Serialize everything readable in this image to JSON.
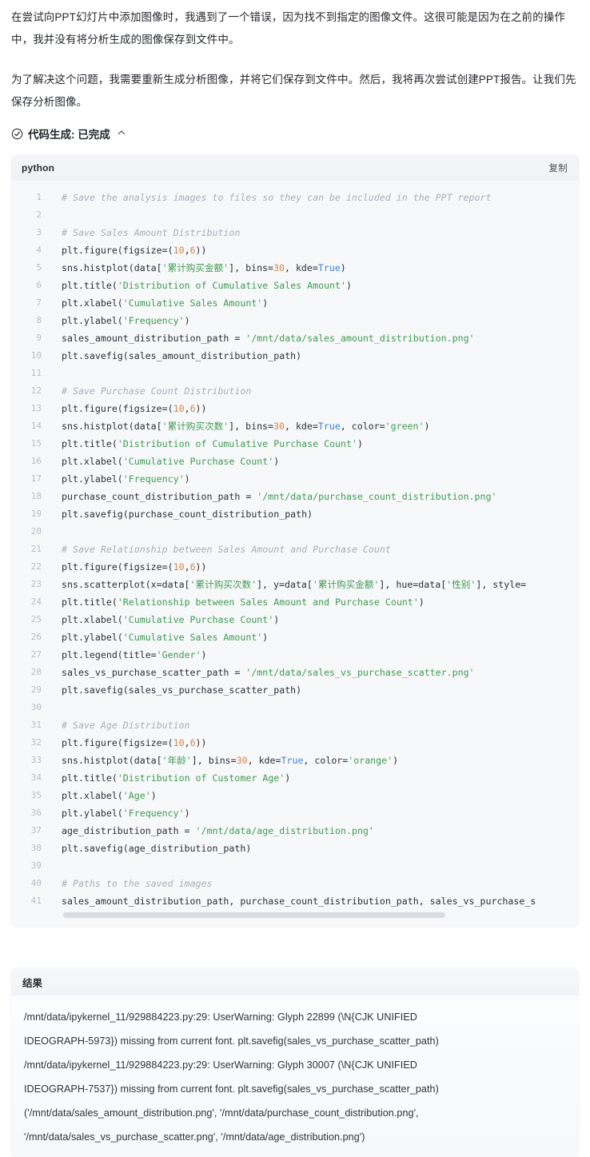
{
  "prose": {
    "paragraph_1": "在尝试向PPT幻灯片中添加图像时，我遇到了一个错误，因为找不到指定的图像文件。这很可能是因为在之前的操作中，我并没有将分析生成的图像保存到文件中。",
    "paragraph_2": "为了解决这个问题，我需要重新生成分析图像，并将它们保存到文件中。然后，我将再次尝试创建PPT报告。让我们先保存分析图像。"
  },
  "status": {
    "icon": "check-circle-icon",
    "label": "代码生成: 已完成",
    "chevron": "chevron-up-icon"
  },
  "code_block": {
    "language": "python",
    "copy_label": "复制",
    "line_numbers": [
      "1",
      "2",
      "3",
      "4",
      "5",
      "6",
      "7",
      "8",
      "9",
      "10",
      "11",
      "12",
      "13",
      "14",
      "15",
      "16",
      "17",
      "18",
      "19",
      "20",
      "21",
      "22",
      "23",
      "24",
      "25",
      "26",
      "27",
      "28",
      "29",
      "30",
      "31",
      "32",
      "33",
      "34",
      "35",
      "36",
      "37",
      "38",
      "39",
      "40",
      "41"
    ],
    "lines": [
      "# Save the analysis images to files so they can be included in the PPT report",
      "",
      "# Save Sales Amount Distribution",
      "plt.figure(figsize=(10,6))",
      "sns.histplot(data['累计购买金额'], bins=30, kde=True)",
      "plt.title('Distribution of Cumulative Sales Amount')",
      "plt.xlabel('Cumulative Sales Amount')",
      "plt.ylabel('Frequency')",
      "sales_amount_distribution_path = '/mnt/data/sales_amount_distribution.png'",
      "plt.savefig(sales_amount_distribution_path)",
      "",
      "# Save Purchase Count Distribution",
      "plt.figure(figsize=(10,6))",
      "sns.histplot(data['累计购买次数'], bins=30, kde=True, color='green')",
      "plt.title('Distribution of Cumulative Purchase Count')",
      "plt.xlabel('Cumulative Purchase Count')",
      "plt.ylabel('Frequency')",
      "purchase_count_distribution_path = '/mnt/data/purchase_count_distribution.png'",
      "plt.savefig(purchase_count_distribution_path)",
      "",
      "# Save Relationship between Sales Amount and Purchase Count",
      "plt.figure(figsize=(10,6))",
      "sns.scatterplot(x=data['累计购买次数'], y=data['累计购买金额'], hue=data['性别'], style=",
      "plt.title('Relationship between Sales Amount and Purchase Count')",
      "plt.xlabel('Cumulative Purchase Count')",
      "plt.ylabel('Cumulative Sales Amount')",
      "plt.legend(title='Gender')",
      "sales_vs_purchase_scatter_path = '/mnt/data/sales_vs_purchase_scatter.png'",
      "plt.savefig(sales_vs_purchase_scatter_path)",
      "",
      "# Save Age Distribution",
      "plt.figure(figsize=(10,6))",
      "sns.histplot(data['年龄'], bins=30, kde=True, color='orange')",
      "plt.title('Distribution of Customer Age')",
      "plt.xlabel('Age')",
      "plt.ylabel('Frequency')",
      "age_distribution_path = '/mnt/data/age_distribution.png'",
      "plt.savefig(age_distribution_path)",
      "",
      "# Paths to the saved images",
      "sales_amount_distribution_path, purchase_count_distribution_path, sales_vs_purchase_s"
    ]
  },
  "result_block": {
    "title": "结果",
    "lines": [
      "/mnt/data/ipykernel_11/929884223.py:29: UserWarning: Glyph 22899 (\\N{CJK UNIFIED",
      "IDEOGRAPH-5973}) missing from current font. plt.savefig(sales_vs_purchase_scatter_path)",
      "/mnt/data/ipykernel_11/929884223.py:29: UserWarning: Glyph 30007 (\\N{CJK UNIFIED",
      "IDEOGRAPH-7537}) missing from current font. plt.savefig(sales_vs_purchase_scatter_path)",
      "('/mnt/data/sales_amount_distribution.png', '/mnt/data/purchase_count_distribution.png',",
      "'/mnt/data/sales_vs_purchase_scatter.png', '/mnt/data/age_distribution.png')"
    ]
  },
  "colors": {
    "comment": "#a9aeb7",
    "string": "#3f9a52",
    "keyword": "#3b82d6",
    "number": "#d28445",
    "code_bg": "#f7f8fa",
    "code_header_bg": "#f2f3f7",
    "text": "#26292e"
  }
}
